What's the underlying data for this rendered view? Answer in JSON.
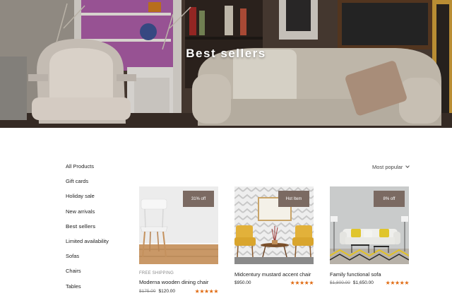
{
  "hero": {
    "title": "Best sellers"
  },
  "sidebar": {
    "items": [
      {
        "label": "All Products"
      },
      {
        "label": "Gift cards"
      },
      {
        "label": "Holiday sale"
      },
      {
        "label": "New arrivals"
      },
      {
        "label": "Best sellers",
        "active": true
      },
      {
        "label": "Limited availability"
      },
      {
        "label": "Sofas"
      },
      {
        "label": "Chairs"
      },
      {
        "label": "Tables"
      }
    ]
  },
  "sort": {
    "label": "Most popular"
  },
  "products": [
    {
      "badge": "31% off",
      "shipping": "FREE SHIPPING",
      "name": "Moderna wooden dining chair",
      "old_price": "$175.00",
      "price": "$120.00",
      "rating": 5
    },
    {
      "badge": "Hot Item",
      "name": "Midcentury mustard accent chair",
      "price": "$950.00",
      "rating": 5
    },
    {
      "badge": "8% off",
      "name": "Family functional sofa",
      "old_price": "$1,800.00",
      "price": "$1,650.00",
      "rating": 5
    }
  ],
  "colors": {
    "badge": "#7b6a62",
    "star": "#e06a10",
    "mustard": "#e2b13a"
  },
  "icons": {
    "sort": "chevron-down-icon",
    "rating": "star-icon"
  }
}
